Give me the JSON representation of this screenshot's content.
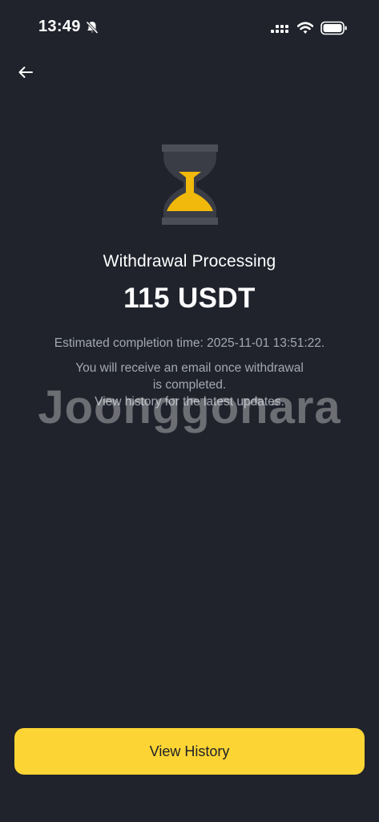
{
  "status_bar": {
    "time": "13:49",
    "icons": [
      "bell-off-icon",
      "signal-icon",
      "wifi-icon",
      "battery-icon"
    ]
  },
  "header": {
    "back_icon": "arrow-left-icon"
  },
  "main": {
    "status_icon": "hourglass-icon",
    "title": "Withdrawal Processing",
    "amount": "115 USDT",
    "estimated_completion": "Estimated completion time: 2025-11-01 13:51:22.",
    "info_lines": [
      "You will receive an email once withdrawal",
      "is completed.",
      "View history for the latest updates."
    ]
  },
  "watermark": "Joonggonara",
  "footer": {
    "view_history_label": "View History"
  },
  "colors": {
    "background": "#20232c",
    "accent": "#fcd535",
    "hourglass_frame": "#4b4e57",
    "secondary_text": "#a4a8b2"
  }
}
